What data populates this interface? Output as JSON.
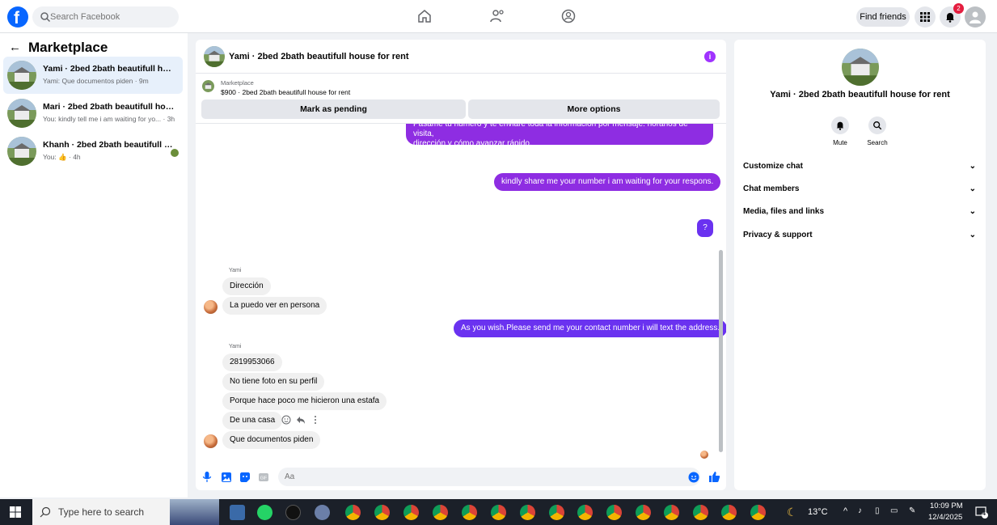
{
  "topbar": {
    "search_placeholder": "Search Facebook",
    "find_friends": "Find friends",
    "notifications_count": "2"
  },
  "sidebar": {
    "back_label": "←",
    "title": "Marketplace",
    "conversations": [
      {
        "name": "Yami · 2bed 2bath beautifull house...",
        "preview": "Yami: Que documentos piden · 9m"
      },
      {
        "name": "Mari · 2bed 2bath beautifull house...",
        "preview": "You: kindly tell me i am waiting for yo... · 3h"
      },
      {
        "name": "Khanh · 2bed 2bath beautifull h...",
        "preview": "You: 👍 · 4h"
      }
    ]
  },
  "chat": {
    "title": "Yami · 2bed 2bath beautifull house for rent",
    "marketplace_label": "Marketplace",
    "listing": "$900 · 2bed 2bath beautifull house for rent",
    "mark_pending": "Mark as pending",
    "more_options": "More options",
    "messages": {
      "m1_line1": "Pásame tu número y te enviaré toda la información por mensaje: horarios de visita,",
      "m1_line2": "dirección y cómo avanzar rápido.",
      "m2": "kindly share me your number i am waiting for your respons.",
      "m3": "?",
      "sender1": "Yami",
      "t1": "Dirección",
      "t2": "La puedo ver en persona",
      "m4": "As you wish.Please send me your contact number i will text the address.",
      "sender2": "Yami",
      "t3": "2819953066",
      "t4": "No tiene foto en su perfil",
      "t5": "Porque hace poco me hicieron una estafa",
      "t6": "De una casa",
      "t7": "Que documentos piden"
    },
    "composer_placeholder": "Aa"
  },
  "details": {
    "title": "Yami · 2bed 2bath beautifull house for rent",
    "mute": "Mute",
    "search": "Search",
    "sections": [
      "Customize chat",
      "Chat members",
      "Media, files and links",
      "Privacy & support"
    ]
  },
  "taskbar": {
    "search_placeholder": "Type here to search",
    "temperature": "13°C",
    "time": "10:09 PM",
    "date": "12/4/2025",
    "notification_count": "4"
  },
  "colors": {
    "brand": "#0866ff",
    "my_bubble": "#8e2de2",
    "my_bubble_alt": "#6a32f0",
    "their_bubble": "#f0f0f0",
    "badge": "#e41e3f"
  }
}
